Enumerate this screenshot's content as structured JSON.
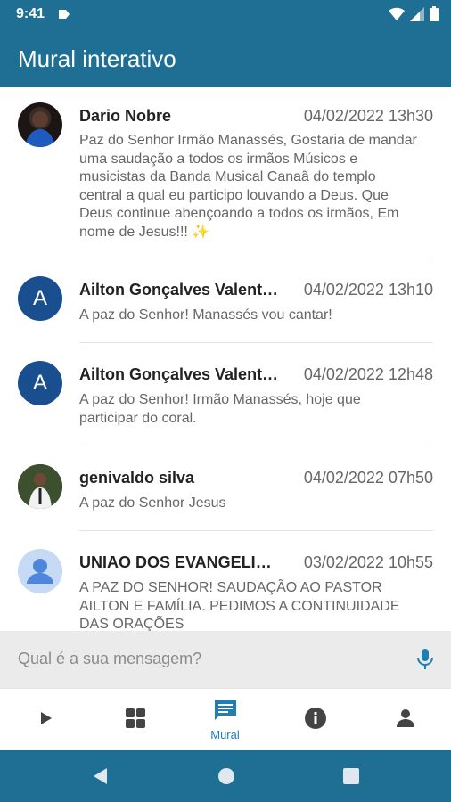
{
  "status_bar": {
    "time": "9:41"
  },
  "app_bar": {
    "title": "Mural interativo"
  },
  "messages": [
    {
      "author": "Dario Nobre",
      "date": "04/02/2022 13h30",
      "text": "Paz do Senhor Irmão Manassés, Gostaria de mandar uma saudação a todos os irmãos Músicos e musicistas da Banda Musical Canaã do templo central a qual eu participo louvando a Deus. Que Deus continue abençoando a todos os irmãos, Em nome de Jesus!!! ✨",
      "avatar": "photo"
    },
    {
      "author": "Ailton Gonçalves Valent…",
      "date": "04/02/2022 13h10",
      "text": "A paz do Senhor! Manassés vou cantar!",
      "avatar": "A"
    },
    {
      "author": "Ailton Gonçalves Valent…",
      "date": "04/02/2022 12h48",
      "text": "A paz do Senhor! Irmão Manassés, hoje que participar do coral.",
      "avatar": "A"
    },
    {
      "author": "genivaldo silva",
      "date": "04/02/2022 07h50",
      "text": "A paz do Senhor Jesus",
      "avatar": "photo"
    },
    {
      "author": "UNIAO DOS EVANGELIC…",
      "date": "03/02/2022 10h55",
      "text": "A PAZ DO SENHOR! SAUDAÇÃO AO PASTOR AILTON E FAMÍLIA. PEDIMOS A CONTINUIDADE DAS ORAÇÕES",
      "avatar": "generic-user-icon"
    }
  ],
  "composer": {
    "placeholder": "Qual é a sua mensagem?"
  },
  "bottom_nav": {
    "items": [
      {
        "icon": "play-icon",
        "label": ""
      },
      {
        "icon": "grid-icon",
        "label": ""
      },
      {
        "icon": "chat-icon",
        "label": "Mural",
        "active": true
      },
      {
        "icon": "info-icon",
        "label": ""
      },
      {
        "icon": "person-icon",
        "label": ""
      }
    ]
  },
  "colors": {
    "primary": "#1f6f94",
    "active_nav": "#1f7fb3",
    "avatar_letter_bg": "#1a4f8f"
  }
}
